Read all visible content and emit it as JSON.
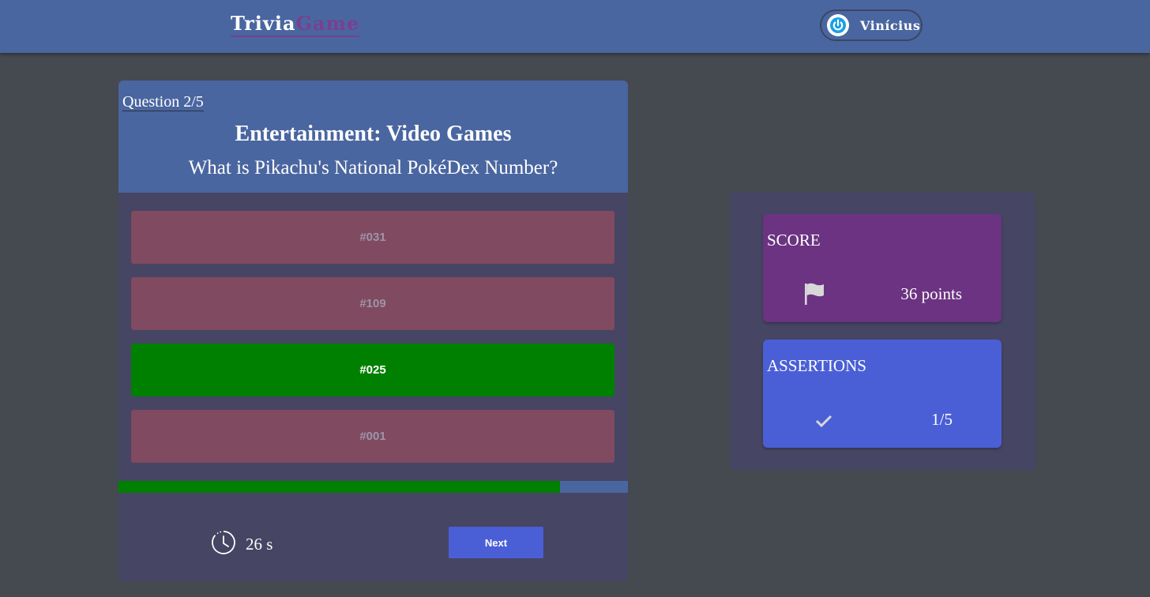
{
  "header": {
    "logo_part1": "Trivia",
    "logo_part2": "Game",
    "user_name": "Vinícius"
  },
  "question": {
    "counter": "Question 2/5",
    "category": "Entertainment: Video Games",
    "text": "What is Pikachu's National PokéDex Number?",
    "answers": [
      {
        "label": "#031",
        "state": "wrong"
      },
      {
        "label": "#109",
        "state": "wrong"
      },
      {
        "label": "#025",
        "state": "correct"
      },
      {
        "label": "#001",
        "state": "wrong"
      }
    ],
    "time_progress": 0.867,
    "timer": "26 s",
    "next_label": "Next"
  },
  "stats": {
    "score_title": "SCORE",
    "score_value": "36 points",
    "assertions_title": "ASSERTIONS",
    "assertions_value": "1/5"
  },
  "icons": {
    "power": "power-icon",
    "clock": "clock-icon",
    "flag": "flag-icon",
    "check": "check-icon"
  },
  "colors": {
    "header_bg": "#4a66a0",
    "page_bg": "#454950",
    "card_bg": "#464563",
    "wrong_answer": "#804a60",
    "correct_answer": "#008000",
    "score_card": "#6b3381",
    "assertions_card": "#4a5fd6",
    "logo_accent": "#7a3f91"
  }
}
